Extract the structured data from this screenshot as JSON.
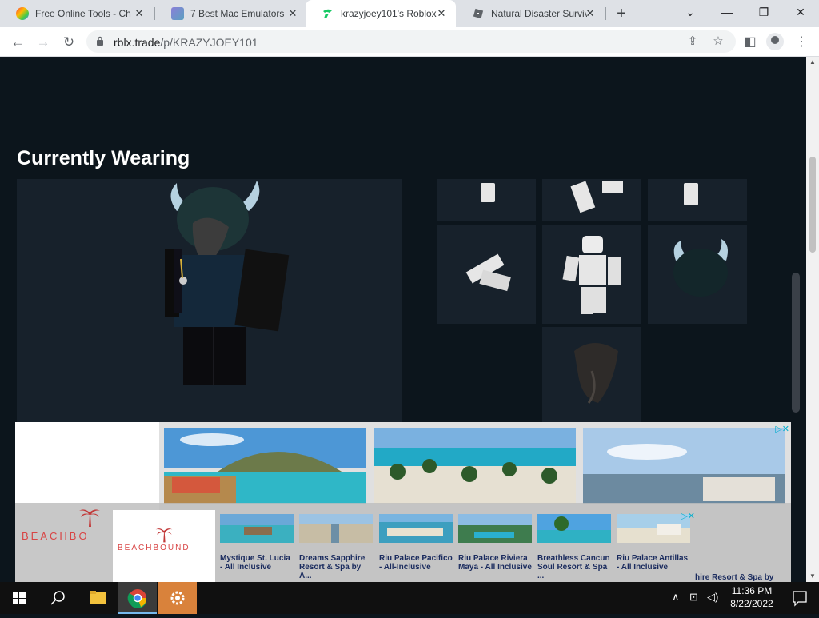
{
  "browser": {
    "tabs": [
      {
        "title": "Free Online Tools - Chr",
        "favicon": "rainbow-icon"
      },
      {
        "title": "7 Best Mac Emulators f",
        "favicon": "emulator-icon"
      },
      {
        "title": "krazyjoey101's Roblox",
        "favicon": "rblx-trade-icon"
      },
      {
        "title": "Natural Disaster Surviv",
        "favicon": "roblox-icon"
      }
    ],
    "url_host": "rblx.trade",
    "url_path": "/p/KRAZYJOEY101"
  },
  "page": {
    "section_title": "Currently Wearing"
  },
  "ads": {
    "adchoice_label": "▷✕",
    "brand": "BEACHBOUND",
    "brand_partial": "BEACHBO",
    "hotels": [
      {
        "name": "Mystique St. Lucia - All Inclusive"
      },
      {
        "name": "Dreams Sapphire Resort & Spa by A..."
      },
      {
        "name": "Riu Palace Pacifico - All-Inclusive"
      },
      {
        "name": "Riu Palace Riviera Maya - All Inclusive"
      },
      {
        "name": "Breathless Cancun Soul Resort & Spa ..."
      },
      {
        "name": "Riu Palace Antillas - All Inclusive"
      }
    ],
    "partial_caption": "hire Resort & Spa by"
  },
  "taskbar": {
    "time": "11:36 PM",
    "date": "8/22/2022"
  },
  "colors": {
    "page_bg": "#0c151c",
    "panel_bg": "#17212b",
    "brand_red": "#d84545"
  }
}
